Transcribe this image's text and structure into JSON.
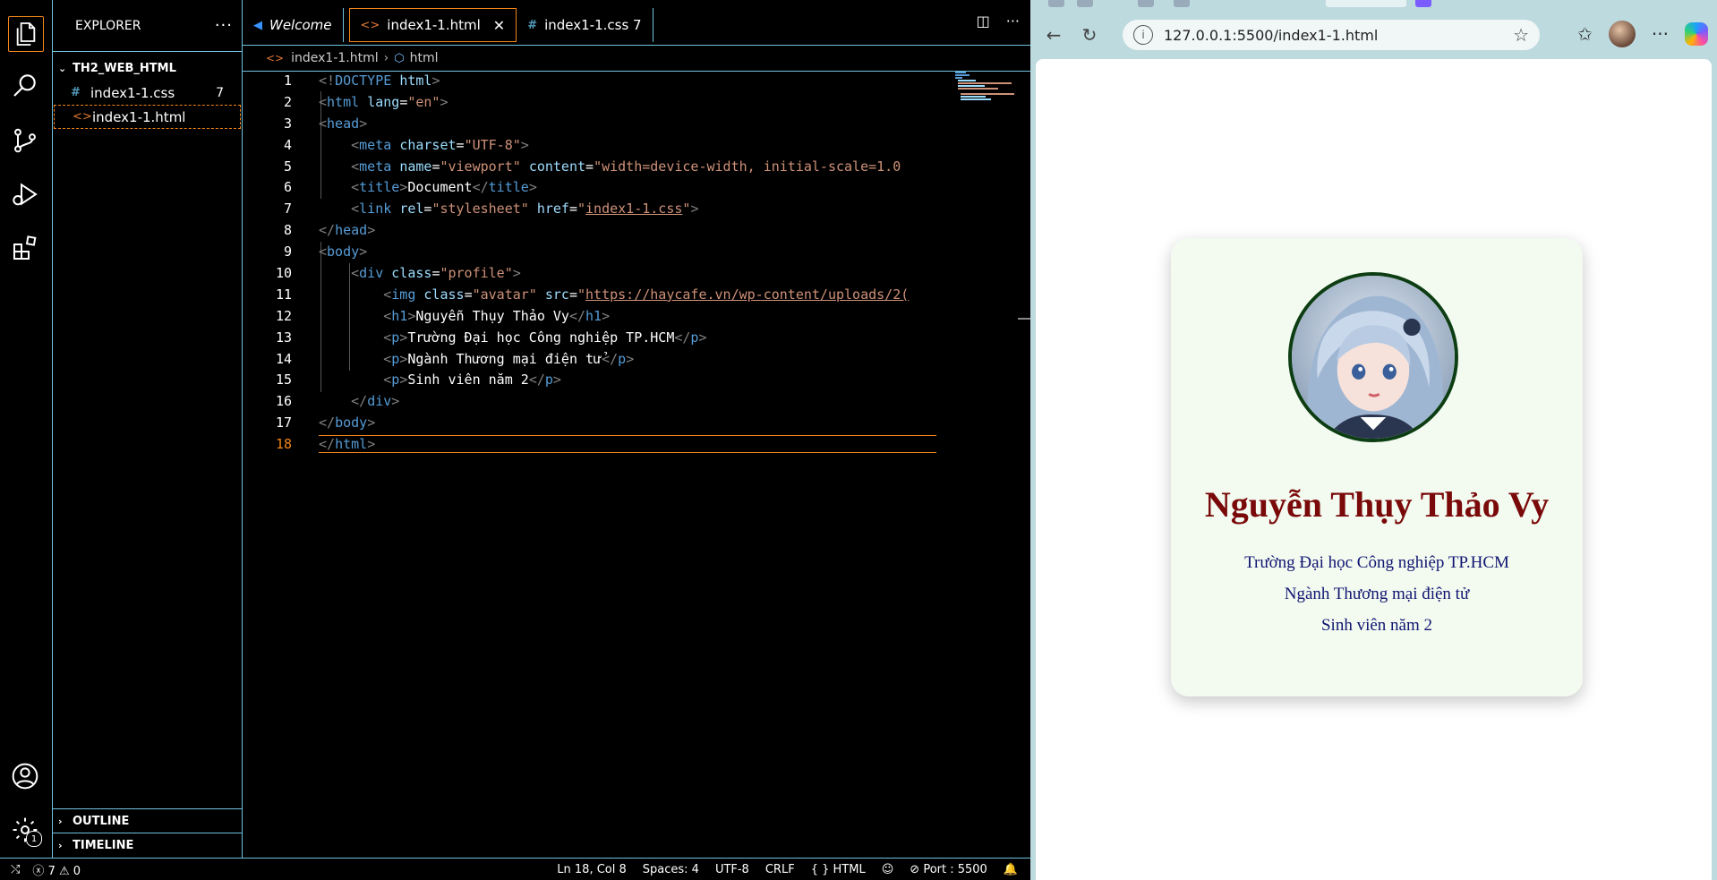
{
  "explorer": {
    "title": "EXPLORER",
    "folder": "TH2_WEB_HTML",
    "files": [
      {
        "name": "index1-1.css",
        "count": "7"
      },
      {
        "name": "index1-1.html",
        "count": ""
      }
    ],
    "outline": "OUTLINE",
    "timeline": "TIMELINE"
  },
  "tabs": [
    {
      "label": "Welcome"
    },
    {
      "label": "index1-1.html"
    },
    {
      "label": "index1-1.css 7"
    }
  ],
  "breadcrumb": {
    "file": "index1-1.html",
    "symbol": "html"
  },
  "code": {
    "lines": [
      "1",
      "2",
      "3",
      "4",
      "5",
      "6",
      "7",
      "8",
      "9",
      "10",
      "11",
      "12",
      "13",
      "14",
      "15",
      "16",
      "17",
      "18"
    ],
    "l1": "<!DOCTYPE html>",
    "l2": "<html lang=\"en\">",
    "l3": "<head>",
    "l4_attr": "charset",
    "l4_val": "\"UTF-8\"",
    "l5_content": "\"width=device-width, initial-scale=1.0",
    "l6_text": "Document",
    "l7_href": "index1-1.css",
    "l10_class": "\"profile\"",
    "l11_class": "\"avatar\"",
    "l11_src": "https://haycafe.vn/wp-content/uploads/2(",
    "l12_text": "Nguyễn Thụy Thảo Vy",
    "l13_text": "Trường Đại học Công nghiệp TP.HCM",
    "l14_text": "Ngành Thương mại điện tử",
    "l15_text": "Sinh viên năm 2"
  },
  "status": {
    "errors": "7",
    "warnings": "0",
    "position": "Ln 18, Col 8",
    "spaces": "Spaces: 4",
    "encoding": "UTF-8",
    "eol": "CRLF",
    "language": "HTML",
    "port": "Port : 5500",
    "settings_badge": "1"
  },
  "browser": {
    "url": "127.0.0.1:5500/index1-1.html"
  },
  "profile": {
    "name": "Nguyễn Thụy Thảo Vy",
    "school": "Trường Đại học Công nghiệp TP.HCM",
    "major": "Ngành Thương mại điện tử",
    "year": "Sinh viên năm 2"
  },
  "colors": {
    "focus_border": "#f38518",
    "contrast_border": "#6fc3df",
    "name_color": "#7a0a0a",
    "text_color": "#101570",
    "card_bg": "#f3fbf1"
  }
}
